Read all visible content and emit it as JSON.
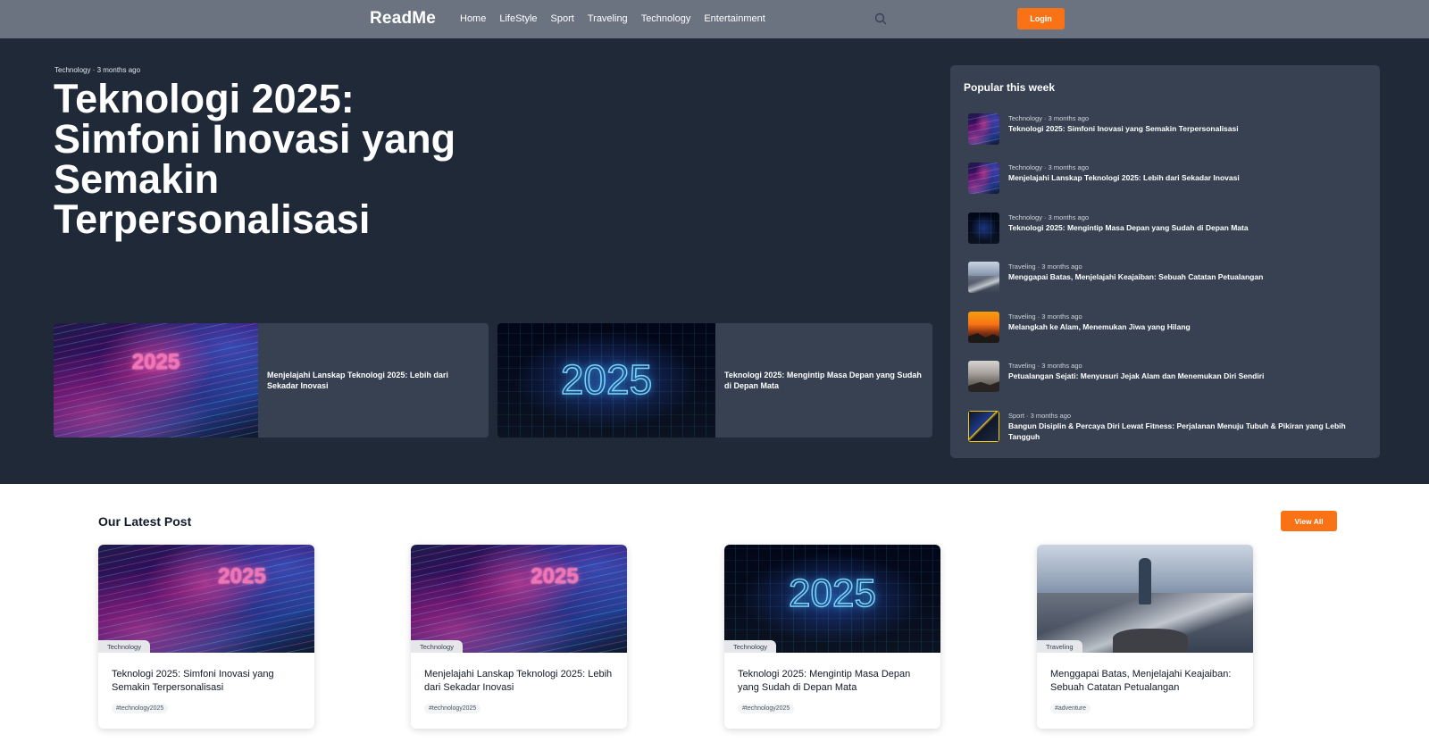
{
  "navbar": {
    "logo": "ReadMe",
    "links": [
      "Home",
      "LifeStyle",
      "Sport",
      "Traveling",
      "Technology",
      "Entertainment"
    ],
    "search_icon": "search-icon",
    "login_label": "Login"
  },
  "hero": {
    "meta": "Technology · 3 months ago",
    "title": "Teknologi 2025: Simfoni Inovasi yang Semakin Terpersonalisasi",
    "features": [
      {
        "title": "Menjelajahi Lanskap Teknologi 2025: Lebih dari Sekadar Inovasi",
        "image_text": "2025"
      },
      {
        "title": "Teknologi 2025: Mengintip Masa Depan yang Sudah di Depan Mata",
        "image_text": "2025"
      }
    ]
  },
  "popular": {
    "heading": "Popular this week",
    "items": [
      {
        "meta": "Technology · 3 months ago",
        "title": "Teknologi 2025: Simfoni Inovasi yang Semakin Terpersonalisasi"
      },
      {
        "meta": "Technology · 3 months ago",
        "title": "Menjelajahi Lanskap Teknologi 2025: Lebih dari Sekadar Inovasi"
      },
      {
        "meta": "Technology · 3 months ago",
        "title": "Teknologi 2025: Mengintip Masa Depan yang Sudah di Depan Mata"
      },
      {
        "meta": "Traveling · 3 months ago",
        "title": "Menggapai Batas, Menjelajahi Keajaiban: Sebuah Catatan Petualangan"
      },
      {
        "meta": "Traveling · 3 months ago",
        "title": "Melangkah ke Alam, Menemukan Jiwa yang Hilang"
      },
      {
        "meta": "Traveling · 3 months ago",
        "title": "Petualangan Sejati: Menyusuri Jejak Alam dan Menemukan Diri Sendiri"
      },
      {
        "meta": "Sport · 3 months ago",
        "title": "Bangun Disiplin & Percaya Diri Lewat Fitness: Perjalanan Menuju Tubuh & Pikiran yang Lebih Tangguh"
      }
    ]
  },
  "latest": {
    "heading": "Our Latest Post",
    "view_all_label": "View All",
    "posts": [
      {
        "badge": "Technology",
        "title": "Teknologi 2025: Simfoni Inovasi yang Semakin Terpersonalisasi",
        "tag": "#technology2025",
        "image_text": "2025"
      },
      {
        "badge": "Technology",
        "title": "Menjelajahi Lanskap Teknologi 2025: Lebih dari Sekadar Inovasi",
        "tag": "#technology2025",
        "image_text": "2025"
      },
      {
        "badge": "Technology",
        "title": "Teknologi 2025: Mengintip Masa Depan yang Sudah di Depan Mata",
        "tag": "#technology2025",
        "image_text": "2025"
      },
      {
        "badge": "Traveling",
        "title": "Menggapai Batas, Menjelajahi Keajaiban: Sebuah Catatan Petualangan",
        "tag": "#adventure"
      }
    ]
  },
  "colors": {
    "navbar": "#6b7280",
    "hero_bg": "#1f2937",
    "panel_bg": "#374151",
    "accent": "#f97316"
  }
}
